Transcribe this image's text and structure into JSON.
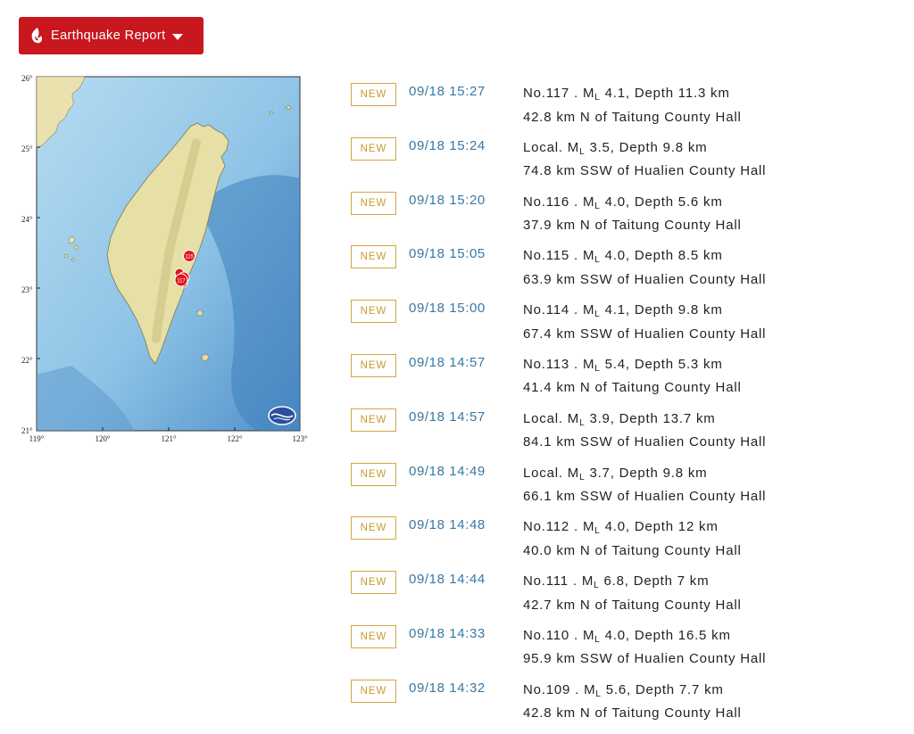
{
  "header": {
    "report_button_label": "Earthquake Report",
    "logo_icon": "cwa-flame-logo-icon",
    "caret_icon": "caret-down-icon",
    "button_color": "#c8171e"
  },
  "map": {
    "lat_labels": [
      "26°",
      "25°",
      "24°",
      "23°",
      "22°",
      "21°"
    ],
    "lon_labels": [
      "119°",
      "120°",
      "121°",
      "122°",
      "123°"
    ],
    "marker_labels": [
      "115",
      "117"
    ],
    "marker_color": "#e0161d",
    "land_color": "#e6dfa6",
    "sea_color": "#a9d5ef"
  },
  "quakes": [
    {
      "badge": "NEW",
      "time": "09/18 15:27",
      "id": "No.117 .",
      "mag_prefix": "M",
      "mag_sub": "L",
      "mag": "4.1,",
      "depth": "Depth 11.3 km",
      "location": "42.8 km N of Taitung County Hall"
    },
    {
      "badge": "NEW",
      "time": "09/18 15:24",
      "id": "Local.",
      "mag_prefix": "M",
      "mag_sub": "L",
      "mag": "3.5,",
      "depth": "Depth 9.8 km",
      "location": "74.8 km SSW of Hualien County Hall"
    },
    {
      "badge": "NEW",
      "time": "09/18 15:20",
      "id": "No.116 .",
      "mag_prefix": "M",
      "mag_sub": "L",
      "mag": "4.0,",
      "depth": "Depth 5.6 km",
      "location": "37.9 km N of Taitung County Hall"
    },
    {
      "badge": "NEW",
      "time": "09/18 15:05",
      "id": "No.115 .",
      "mag_prefix": "M",
      "mag_sub": "L",
      "mag": "4.0,",
      "depth": "Depth 8.5 km",
      "location": "63.9 km SSW of Hualien County Hall"
    },
    {
      "badge": "NEW",
      "time": "09/18 15:00",
      "id": "No.114 .",
      "mag_prefix": "M",
      "mag_sub": "L",
      "mag": "4.1,",
      "depth": "Depth 9.8 km",
      "location": "67.4 km SSW of Hualien County Hall"
    },
    {
      "badge": "NEW",
      "time": "09/18 14:57",
      "id": "No.113 .",
      "mag_prefix": "M",
      "mag_sub": "L",
      "mag": "5.4,",
      "depth": "Depth 5.3 km",
      "location": "41.4 km N of Taitung County Hall"
    },
    {
      "badge": "NEW",
      "time": "09/18 14:57",
      "id": "Local.",
      "mag_prefix": "M",
      "mag_sub": "L",
      "mag": "3.9,",
      "depth": "Depth 13.7 km",
      "location": "84.1 km SSW of Hualien County Hall"
    },
    {
      "badge": "NEW",
      "time": "09/18 14:49",
      "id": "Local.",
      "mag_prefix": "M",
      "mag_sub": "L",
      "mag": "3.7,",
      "depth": "Depth 9.8 km",
      "location": "66.1 km SSW of Hualien County Hall"
    },
    {
      "badge": "NEW",
      "time": "09/18 14:48",
      "id": "No.112 .",
      "mag_prefix": "M",
      "mag_sub": "L",
      "mag": "4.0,",
      "depth": "Depth 12 km",
      "location": "40.0 km N of Taitung County Hall"
    },
    {
      "badge": "NEW",
      "time": "09/18 14:44",
      "id": "No.111 .",
      "mag_prefix": "M",
      "mag_sub": "L",
      "mag": "6.8,",
      "depth": "Depth 7 km",
      "location": "42.7 km N of Taitung County Hall"
    },
    {
      "badge": "NEW",
      "time": "09/18 14:33",
      "id": "No.110 .",
      "mag_prefix": "M",
      "mag_sub": "L",
      "mag": "4.0,",
      "depth": "Depth 16.5 km",
      "location": "95.9 km SSW of Hualien County Hall"
    },
    {
      "badge": "NEW",
      "time": "09/18 14:32",
      "id": "No.109 .",
      "mag_prefix": "M",
      "mag_sub": "L",
      "mag": "5.6,",
      "depth": "Depth 7.7 km",
      "location": "42.8 km N of Taitung County Hall"
    }
  ]
}
